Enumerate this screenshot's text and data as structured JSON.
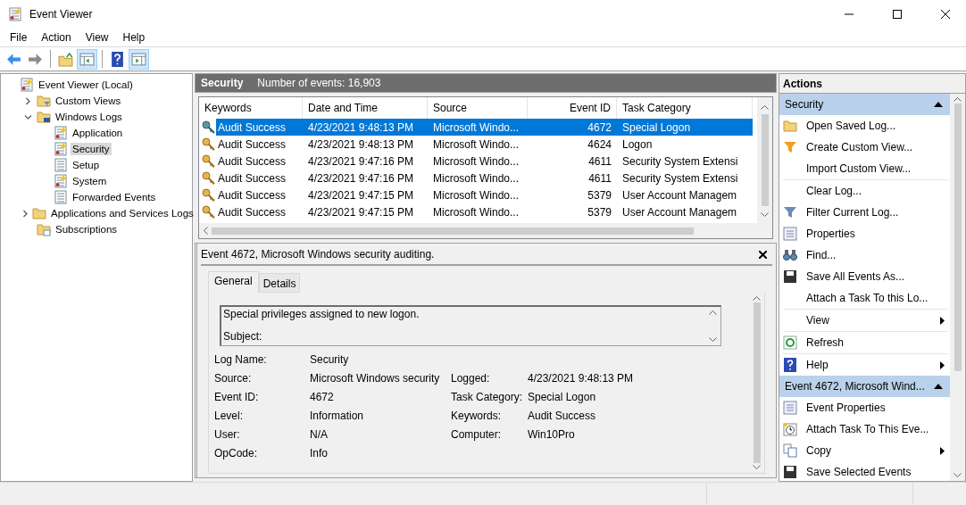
{
  "window": {
    "title": "Event Viewer"
  },
  "menu": [
    "File",
    "Action",
    "View",
    "Help"
  ],
  "toolbar": [
    {
      "kind": "back",
      "pressed": false
    },
    {
      "kind": "forward",
      "pressed": false
    },
    {
      "kind": "sep"
    },
    {
      "kind": "up",
      "pressed": false
    },
    {
      "kind": "pane",
      "pressed": true
    },
    {
      "kind": "sep"
    },
    {
      "kind": "help",
      "pressed": false
    },
    {
      "kind": "pane2",
      "pressed": true
    }
  ],
  "tree": [
    {
      "label": "Event Viewer (Local)",
      "kind": "log-warn",
      "selected": false,
      "children": [
        {
          "label": "Custom Views",
          "kind": "filter-folder",
          "selected": false,
          "expanded": false
        },
        {
          "label": "Windows Logs",
          "kind": "pc-folder",
          "selected": false,
          "expanded": true,
          "children": [
            {
              "label": "Application",
              "kind": "log-warn",
              "selected": false
            },
            {
              "label": "Security",
              "kind": "log-warn",
              "selected": true
            },
            {
              "label": "Setup",
              "kind": "log",
              "selected": false
            },
            {
              "label": "System",
              "kind": "log-warn",
              "selected": false
            },
            {
              "label": "Forwarded Events",
              "kind": "log",
              "selected": false
            }
          ]
        },
        {
          "label": "Applications and Services Logs",
          "kind": "folder",
          "selected": false,
          "expanded": false
        },
        {
          "label": "Subscriptions",
          "kind": "sub-folder",
          "selected": false
        }
      ]
    }
  ],
  "log_header": {
    "title": "Security",
    "count": "Number of events: 16,903"
  },
  "table": {
    "columns": [
      "Keywords",
      "Date and Time",
      "Source",
      "Event ID",
      "Task Category"
    ],
    "rows": [
      {
        "selected": true,
        "cells": [
          "Audit Success",
          "4/23/2021 9:48:13 PM",
          "Microsoft Windo...",
          "4672",
          "Special Logon"
        ]
      },
      {
        "selected": false,
        "cells": [
          "Audit Success",
          "4/23/2021 9:48:13 PM",
          "Microsoft Windo...",
          "4624",
          "Logon"
        ]
      },
      {
        "selected": false,
        "cells": [
          "Audit Success",
          "4/23/2021 9:47:16 PM",
          "Microsoft Windo...",
          "4611",
          "Security System Extensi"
        ]
      },
      {
        "selected": false,
        "cells": [
          "Audit Success",
          "4/23/2021 9:47:16 PM",
          "Microsoft Windo...",
          "4611",
          "Security System Extensi"
        ]
      },
      {
        "selected": false,
        "cells": [
          "Audit Success",
          "4/23/2021 9:47:15 PM",
          "Microsoft Windo...",
          "5379",
          "User Account Managem"
        ]
      },
      {
        "selected": false,
        "cells": [
          "Audit Success",
          "4/23/2021 9:47:15 PM",
          "Microsoft Windo...",
          "5379",
          "User Account Managem"
        ]
      }
    ]
  },
  "detail": {
    "title": "Event 4672, Microsoft Windows security auditing.",
    "tabs": [
      {
        "label": "General",
        "selected": true
      },
      {
        "label": "Details",
        "selected": false
      }
    ],
    "description": [
      "Special privileges assigned to new logon.",
      "Subject:"
    ],
    "rows": [
      [
        {
          "label": "Log Name:",
          "value": "Security"
        }
      ],
      [
        {
          "label": "Source:",
          "value": "Microsoft Windows security"
        },
        {
          "label": "Logged:",
          "value": "4/23/2021 9:48:13 PM"
        }
      ],
      [
        {
          "label": "Event ID:",
          "value": "4672"
        },
        {
          "label": "Task Category:",
          "value": "Special Logon"
        }
      ],
      [
        {
          "label": "Level:",
          "value": "Information"
        },
        {
          "label": "Keywords:",
          "value": "Audit Success"
        }
      ],
      [
        {
          "label": "User:",
          "value": "N/A"
        },
        {
          "label": "Computer:",
          "value": "Win10Pro"
        }
      ],
      [
        {
          "label": "OpCode:",
          "value": "Info"
        }
      ]
    ]
  },
  "actions": {
    "title": "Actions",
    "sections": [
      {
        "title": "Security",
        "expanded": true,
        "groups": [
          [
            {
              "label": "Open Saved Log...",
              "kind": "folder",
              "submenu": false
            },
            {
              "label": "Create Custom View...",
              "kind": "filter-gold",
              "submenu": false
            },
            {
              "label": "Import Custom View...",
              "kind": "none",
              "submenu": false
            }
          ],
          [
            {
              "label": "Clear Log...",
              "kind": "none",
              "submenu": false
            },
            {
              "label": "Filter Current Log...",
              "kind": "filter",
              "submenu": false
            },
            {
              "label": "Properties",
              "kind": "properties",
              "submenu": false
            },
            {
              "label": "Find...",
              "kind": "binoculars",
              "submenu": false
            },
            {
              "label": "Save All Events As...",
              "kind": "save",
              "submenu": false
            },
            {
              "label": "Attach a Task To this Lo...",
              "kind": "none",
              "submenu": false
            }
          ],
          [
            {
              "label": "View",
              "kind": "none",
              "submenu": true
            }
          ],
          [
            {
              "label": "Refresh",
              "kind": "refresh",
              "submenu": false
            }
          ],
          [
            {
              "label": "Help",
              "kind": "help",
              "submenu": true
            }
          ]
        ]
      },
      {
        "title": "Event 4672, Microsoft Wind...",
        "expanded": true,
        "groups": [
          [
            {
              "label": "Event Properties",
              "kind": "properties",
              "submenu": false
            },
            {
              "label": "Attach Task To This Eve...",
              "kind": "clock",
              "submenu": false
            },
            {
              "label": "Copy",
              "kind": "copy",
              "submenu": true
            },
            {
              "label": "Save Selected Events",
              "kind": "save",
              "submenu": false
            }
          ]
        ]
      }
    ]
  }
}
